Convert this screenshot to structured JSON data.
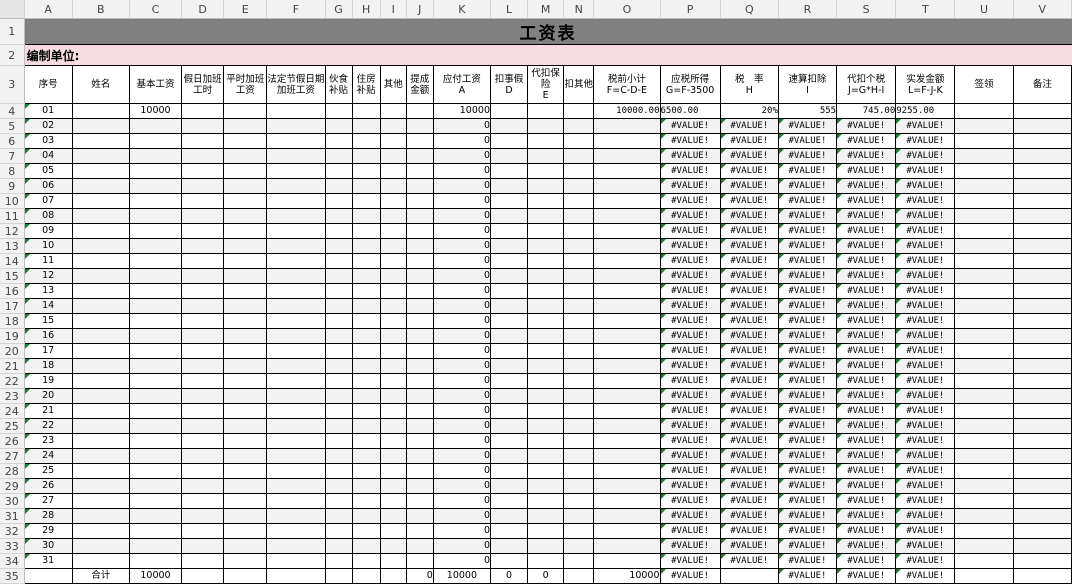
{
  "columns": [
    "A",
    "B",
    "C",
    "D",
    "E",
    "F",
    "G",
    "H",
    "I",
    "J",
    "K",
    "L",
    "M",
    "N",
    "O",
    "P",
    "Q",
    "R",
    "S",
    "T",
    "U",
    "V"
  ],
  "title": "工资表",
  "unit_label": "编制单位:",
  "headers": [
    "序号",
    "姓名",
    "基本工资",
    "假日加班工时",
    "平时加班工资",
    "法定节假日期加班工资",
    "伙食补贴",
    "住房补贴",
    "其他",
    "提成金额",
    "应付工资\nA",
    "扣事假\nD",
    "代扣保险\nE",
    "扣其他",
    "税前小计\nF=C-D-E",
    "应税所得\nG=F-3500",
    "税　率\nH",
    "速算扣除\nI",
    "代扣个税\nJ=G*H-I",
    "实发金额\nL=F-J-K",
    "签领",
    "备注"
  ],
  "first_row": {
    "seq": "01",
    "base": "10000",
    "payable": "10000",
    "pretax": "10000.00",
    "taxable": "6500.00",
    "rate": "20%",
    "deduction": "555",
    "tax": "745.00",
    "net": "9255.00"
  },
  "rows": [
    {
      "seq": "02",
      "payable": "0",
      "err": "#VALUE!"
    },
    {
      "seq": "03",
      "payable": "0",
      "err": "#VALUE!"
    },
    {
      "seq": "04",
      "payable": "0",
      "err": "#VALUE!"
    },
    {
      "seq": "05",
      "payable": "0",
      "err": "#VALUE!"
    },
    {
      "seq": "06",
      "payable": "0",
      "err": "#VALUE!"
    },
    {
      "seq": "07",
      "payable": "0",
      "err": "#VALUE!"
    },
    {
      "seq": "08",
      "payable": "0",
      "err": "#VALUE!"
    },
    {
      "seq": "09",
      "payable": "0",
      "err": "#VALUE!"
    },
    {
      "seq": "10",
      "payable": "0",
      "err": "#VALUE!"
    },
    {
      "seq": "11",
      "payable": "0",
      "err": "#VALUE!"
    },
    {
      "seq": "12",
      "payable": "0",
      "err": "#VALUE!"
    },
    {
      "seq": "13",
      "payable": "0",
      "err": "#VALUE!"
    },
    {
      "seq": "14",
      "payable": "0",
      "err": "#VALUE!"
    },
    {
      "seq": "15",
      "payable": "0",
      "err": "#VALUE!"
    },
    {
      "seq": "16",
      "payable": "0",
      "err": "#VALUE!"
    },
    {
      "seq": "17",
      "payable": "0",
      "err": "#VALUE!"
    },
    {
      "seq": "18",
      "payable": "0",
      "err": "#VALUE!"
    },
    {
      "seq": "19",
      "payable": "0",
      "err": "#VALUE!"
    },
    {
      "seq": "20",
      "payable": "0",
      "err": "#VALUE!"
    },
    {
      "seq": "21",
      "payable": "0",
      "err": "#VALUE!"
    },
    {
      "seq": "22",
      "payable": "0",
      "err": "#VALUE!"
    },
    {
      "seq": "23",
      "payable": "0",
      "err": "#VALUE!"
    },
    {
      "seq": "24",
      "payable": "0",
      "err": "#VALUE!"
    },
    {
      "seq": "25",
      "payable": "0",
      "err": "#VALUE!"
    },
    {
      "seq": "26",
      "payable": "0",
      "err": "#VALUE!"
    },
    {
      "seq": "27",
      "payable": "0",
      "err": "#VALUE!"
    },
    {
      "seq": "28",
      "payable": "0",
      "err": "#VALUE!"
    },
    {
      "seq": "29",
      "payable": "0",
      "err": "#VALUE!"
    },
    {
      "seq": "30",
      "payable": "0",
      "err": "#VALUE!"
    },
    {
      "seq": "31",
      "payable": "0",
      "err": "#VALUE!"
    }
  ],
  "total_row": {
    "label": "合计",
    "base": "10000",
    "commission": "0",
    "payable": "10000",
    "leave": "0",
    "insurance": "0",
    "pretax": "10000",
    "err": "#VALUE!"
  },
  "colors": {
    "title_bg": "#808080",
    "unit_bg": "#f7dde2",
    "stripe": "#f2f2f2",
    "error_marker": "#1a7a35"
  }
}
